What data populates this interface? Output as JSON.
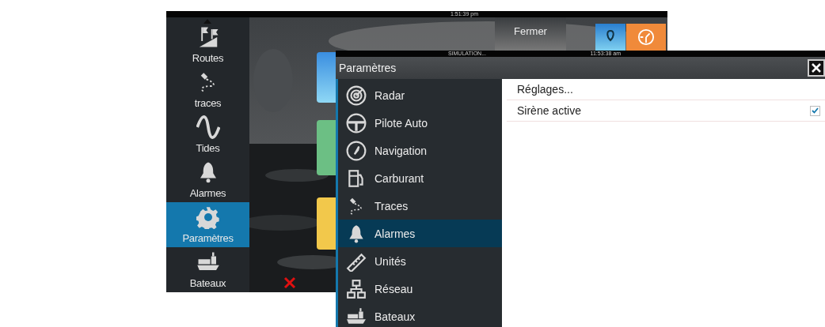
{
  "back_screen": {
    "clock": "1:51:39 pm",
    "close_label": "Fermer",
    "sidebar": [
      {
        "label": "Routes",
        "kind": "routes",
        "selected": false
      },
      {
        "label": "traces",
        "kind": "track",
        "selected": false
      },
      {
        "label": "Tides",
        "kind": "wave",
        "selected": false
      },
      {
        "label": "Alarmes",
        "kind": "bell",
        "selected": false
      },
      {
        "label": "Paramètres",
        "kind": "gear",
        "selected": true
      },
      {
        "label": "Bateaux",
        "kind": "ship",
        "selected": false
      }
    ]
  },
  "settings": {
    "status": "SIMULATION...",
    "clock": "11:53:38 am",
    "title": "Paramètres",
    "categories": [
      {
        "label": "Radar",
        "kind": "radar",
        "selected": false
      },
      {
        "label": "Pilote Auto",
        "kind": "wheel",
        "selected": false
      },
      {
        "label": "Navigation",
        "kind": "compass",
        "selected": false
      },
      {
        "label": "Carburant",
        "kind": "fuel",
        "selected": false
      },
      {
        "label": "Traces",
        "kind": "track",
        "selected": false
      },
      {
        "label": "Alarmes",
        "kind": "bell",
        "selected": true
      },
      {
        "label": "Unités",
        "kind": "ruler",
        "selected": false
      },
      {
        "label": "Réseau",
        "kind": "network",
        "selected": false
      },
      {
        "label": "Bateaux",
        "kind": "ship",
        "selected": false
      }
    ],
    "options": [
      {
        "kind": "action",
        "label": "Réglages..."
      },
      {
        "kind": "checkbox",
        "label": "Sirène active",
        "checked": true
      }
    ]
  }
}
